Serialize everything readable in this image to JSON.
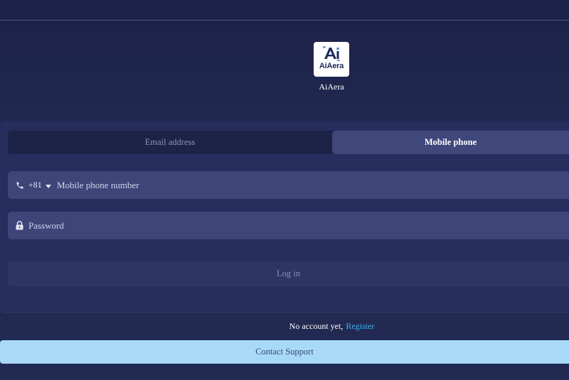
{
  "app": {
    "logo_text": "AiAera",
    "name": "AiAera"
  },
  "tabs": [
    {
      "label": "Email address",
      "active": false
    },
    {
      "label": "Mobile phone",
      "active": true
    }
  ],
  "phone": {
    "country_code": "+81",
    "placeholder": "Mobile phone number",
    "value": "",
    "icon": "phone-icon"
  },
  "password": {
    "placeholder": "Password",
    "value": "",
    "icon": "lock-icon"
  },
  "login": {
    "label": "Log in"
  },
  "register": {
    "prompt": "No account yet,",
    "link_label": "Register"
  },
  "support": {
    "label": "Contact Support"
  },
  "colors": {
    "background": "#222a52",
    "panel": "#262e5e",
    "input": "#3d4579",
    "active_tab": "#3f477b",
    "link": "#3fb0f0",
    "support_button": "#a8d9f7"
  }
}
